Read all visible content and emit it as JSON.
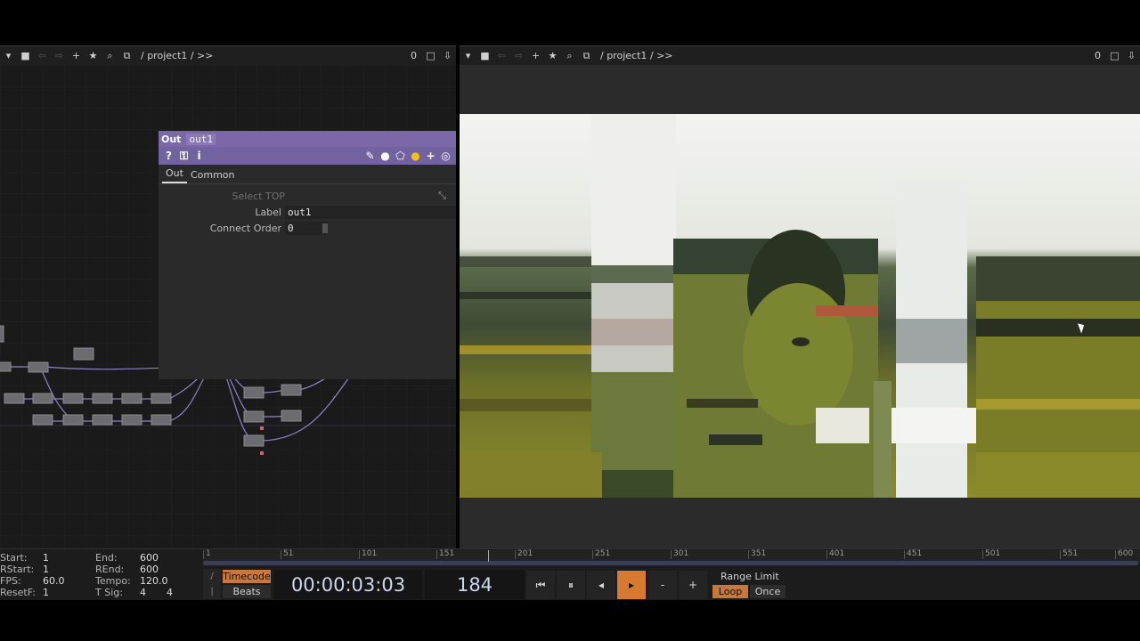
{
  "toolbar_left": {
    "path": "/ project1 / >>",
    "counter": "0"
  },
  "toolbar_right": {
    "path": "/ project1 / >>",
    "counter": "0"
  },
  "param": {
    "op_type": "Out",
    "op_name": "out1",
    "tabs": [
      "Out",
      "Common"
    ],
    "select_label": "Select TOP",
    "label_label": "Label",
    "label_value": "out1",
    "order_label": "Connect Order",
    "order_value": "0"
  },
  "timeline": {
    "start_label": "Start:",
    "start": "1",
    "rstart_label": "RStart:",
    "rstart": "1",
    "fps_label": "FPS:",
    "fps": "60.0",
    "resetf_label": "ResetF:",
    "resetf": "1",
    "end_label": "End:",
    "end": "600",
    "rend_label": "REnd:",
    "rend": "600",
    "tempo_label": "Tempo:",
    "tempo": "120.0",
    "tsig_label": "T Sig:",
    "tsig_a": "4",
    "tsig_b": "4",
    "ticks": [
      "1",
      "51",
      "101",
      "151",
      "201",
      "251",
      "301",
      "351",
      "401",
      "451",
      "501",
      "551",
      "600"
    ],
    "timecode_btn": "Timecode",
    "beats_btn": "Beats",
    "timecode": "00:00:03:03",
    "frame": "184",
    "range_limit": "Range Limit",
    "loop": "Loop",
    "once": "Once"
  }
}
